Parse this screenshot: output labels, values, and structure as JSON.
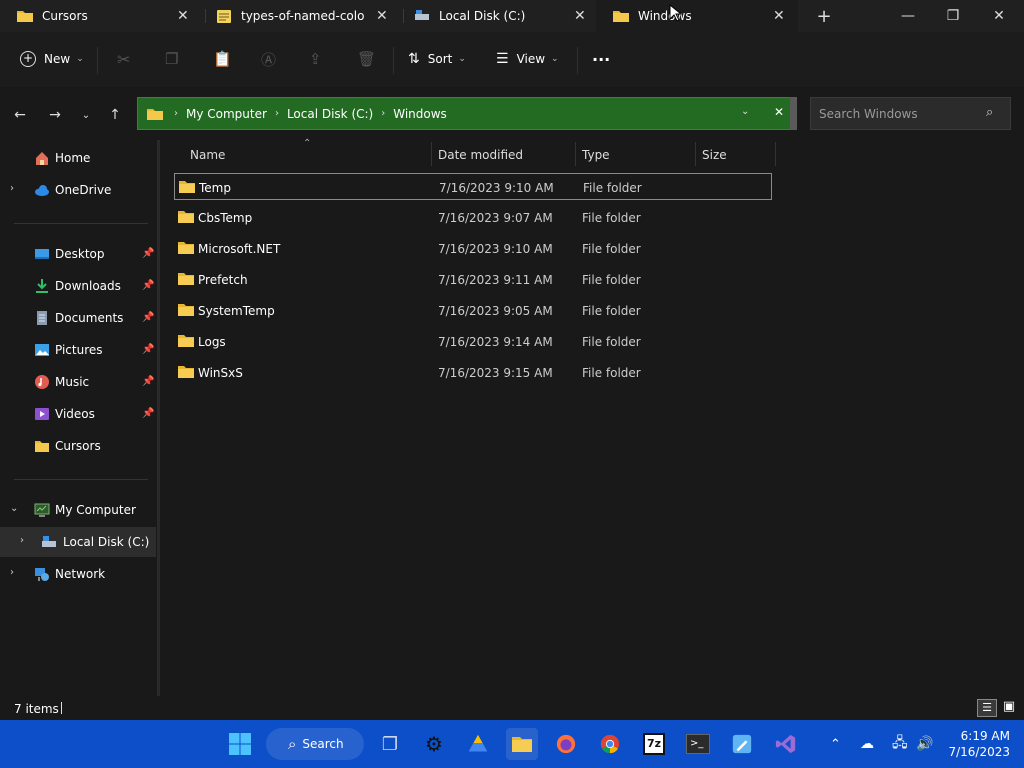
{
  "tabs": [
    {
      "label": "Cursors"
    },
    {
      "label": "types-of-named-colors"
    },
    {
      "label": "Local Disk (C:)"
    },
    {
      "label": "Windows"
    }
  ],
  "toolbar": {
    "new_label": "New",
    "sort_label": "Sort",
    "view_label": "View",
    "more_label": "···"
  },
  "address": {
    "crumbs": [
      "My Computer",
      "Local Disk (C:)",
      "Windows"
    ]
  },
  "search": {
    "placeholder": "Search Windows"
  },
  "sidebar": {
    "home": "Home",
    "onedrive": "OneDrive",
    "desktop": "Desktop",
    "downloads": "Downloads",
    "documents": "Documents",
    "pictures": "Pictures",
    "music": "Music",
    "videos": "Videos",
    "cursors": "Cursors",
    "mycomputer": "My Computer",
    "localdisk": "Local Disk (C:)",
    "network": "Network"
  },
  "columns": {
    "name": "Name",
    "date": "Date modified",
    "type": "Type",
    "size": "Size"
  },
  "files": [
    {
      "name": "Temp",
      "date": "7/16/2023 9:10 AM",
      "type": "File folder"
    },
    {
      "name": "CbsTemp",
      "date": "7/16/2023 9:07 AM",
      "type": "File folder"
    },
    {
      "name": "Microsoft.NET",
      "date": "7/16/2023 9:10 AM",
      "type": "File folder"
    },
    {
      "name": "Prefetch",
      "date": "7/16/2023 9:11 AM",
      "type": "File folder"
    },
    {
      "name": "SystemTemp",
      "date": "7/16/2023 9:05 AM",
      "type": "File folder"
    },
    {
      "name": "Logs",
      "date": "7/16/2023 9:14 AM",
      "type": "File folder"
    },
    {
      "name": "WinSxS",
      "date": "7/16/2023 9:15 AM",
      "type": "File folder"
    }
  ],
  "status": {
    "count": "7 items"
  },
  "taskbar": {
    "search_label": "Search",
    "time": "6:19 AM",
    "date": "7/16/2023"
  },
  "colors": {
    "accent": "#0c4fc8",
    "address_bg": "#236b23",
    "folder": "#e8b730"
  }
}
